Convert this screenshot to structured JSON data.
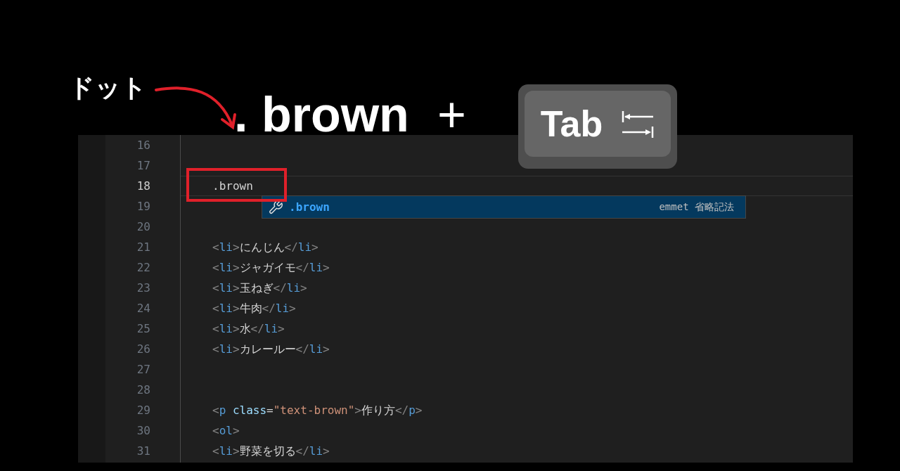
{
  "annotation": {
    "label": "ドット"
  },
  "headline": {
    "text": ". brown",
    "operator": "+",
    "key": "Tab"
  },
  "editor": {
    "lines": [
      {
        "number": "16",
        "current": false
      },
      {
        "number": "17",
        "current": false
      },
      {
        "number": "18",
        "current": true,
        "tokens": [
          {
            "kind": "text",
            "text": ".brown"
          }
        ]
      },
      {
        "number": "19",
        "current": false
      },
      {
        "number": "20",
        "current": false
      },
      {
        "number": "21",
        "current": false,
        "tokens": [
          {
            "kind": "punct",
            "text": "<"
          },
          {
            "kind": "tag",
            "text": "li"
          },
          {
            "kind": "punct",
            "text": ">"
          },
          {
            "kind": "text",
            "text": "にんじん"
          },
          {
            "kind": "punct",
            "text": "</"
          },
          {
            "kind": "tag",
            "text": "li"
          },
          {
            "kind": "punct",
            "text": ">"
          }
        ]
      },
      {
        "number": "22",
        "current": false,
        "tokens": [
          {
            "kind": "punct",
            "text": "<"
          },
          {
            "kind": "tag",
            "text": "li"
          },
          {
            "kind": "punct",
            "text": ">"
          },
          {
            "kind": "text",
            "text": "ジャガイモ"
          },
          {
            "kind": "punct",
            "text": "</"
          },
          {
            "kind": "tag",
            "text": "li"
          },
          {
            "kind": "punct",
            "text": ">"
          }
        ]
      },
      {
        "number": "23",
        "current": false,
        "tokens": [
          {
            "kind": "punct",
            "text": "<"
          },
          {
            "kind": "tag",
            "text": "li"
          },
          {
            "kind": "punct",
            "text": ">"
          },
          {
            "kind": "text",
            "text": "玉ねぎ"
          },
          {
            "kind": "punct",
            "text": "</"
          },
          {
            "kind": "tag",
            "text": "li"
          },
          {
            "kind": "punct",
            "text": ">"
          }
        ]
      },
      {
        "number": "24",
        "current": false,
        "tokens": [
          {
            "kind": "punct",
            "text": "<"
          },
          {
            "kind": "tag",
            "text": "li"
          },
          {
            "kind": "punct",
            "text": ">"
          },
          {
            "kind": "text",
            "text": "牛肉"
          },
          {
            "kind": "punct",
            "text": "</"
          },
          {
            "kind": "tag",
            "text": "li"
          },
          {
            "kind": "punct",
            "text": ">"
          }
        ]
      },
      {
        "number": "25",
        "current": false,
        "tokens": [
          {
            "kind": "punct",
            "text": "<"
          },
          {
            "kind": "tag",
            "text": "li"
          },
          {
            "kind": "punct",
            "text": ">"
          },
          {
            "kind": "text",
            "text": "水"
          },
          {
            "kind": "punct",
            "text": "</"
          },
          {
            "kind": "tag",
            "text": "li"
          },
          {
            "kind": "punct",
            "text": ">"
          }
        ]
      },
      {
        "number": "26",
        "current": false,
        "tokens": [
          {
            "kind": "punct",
            "text": "<"
          },
          {
            "kind": "tag",
            "text": "li"
          },
          {
            "kind": "punct",
            "text": ">"
          },
          {
            "kind": "text",
            "text": "カレールー"
          },
          {
            "kind": "punct",
            "text": "</"
          },
          {
            "kind": "tag",
            "text": "li"
          },
          {
            "kind": "punct",
            "text": ">"
          }
        ]
      },
      {
        "number": "27",
        "current": false
      },
      {
        "number": "28",
        "current": false
      },
      {
        "number": "29",
        "current": false,
        "tokens": [
          {
            "kind": "punct",
            "text": "<"
          },
          {
            "kind": "tag",
            "text": "p"
          },
          {
            "kind": "attr",
            "text": " class"
          },
          {
            "kind": "text",
            "text": "="
          },
          {
            "kind": "string",
            "text": "\"text-brown\""
          },
          {
            "kind": "punct",
            "text": ">"
          },
          {
            "kind": "text",
            "text": "作り方"
          },
          {
            "kind": "punct",
            "text": "</"
          },
          {
            "kind": "tag",
            "text": "p"
          },
          {
            "kind": "punct",
            "text": ">"
          }
        ]
      },
      {
        "number": "30",
        "current": false,
        "tokens": [
          {
            "kind": "punct",
            "text": "<"
          },
          {
            "kind": "tag",
            "text": "ol"
          },
          {
            "kind": "punct",
            "text": ">"
          }
        ]
      },
      {
        "number": "31",
        "current": false,
        "tokens": [
          {
            "kind": "punct",
            "text": "<"
          },
          {
            "kind": "tag",
            "text": "li"
          },
          {
            "kind": "punct",
            "text": ">"
          },
          {
            "kind": "text",
            "text": "野菜を切る"
          },
          {
            "kind": "punct",
            "text": "</"
          },
          {
            "kind": "tag",
            "text": "li"
          },
          {
            "kind": "punct",
            "text": ">"
          }
        ]
      }
    ]
  },
  "suggestion": {
    "label": ".brown",
    "detail": "emmet 省略記法",
    "selected": true
  }
}
